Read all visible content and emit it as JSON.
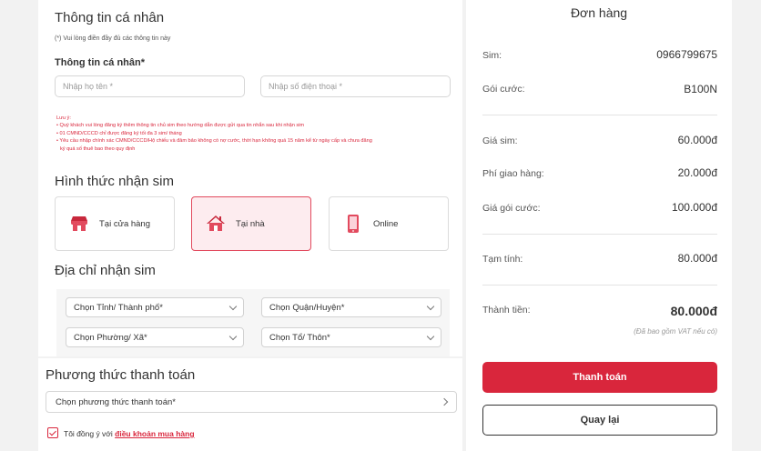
{
  "personal": {
    "title": "Thông tin cá nhân",
    "required_note": "(*) Vui lòng điền đầy đủ các thông tin này",
    "subhead": "Thông tin cá nhân*",
    "name_placeholder": "Nhập họ tên *",
    "phone_placeholder": "Nhập số điện thoại *",
    "legal_lines": [
      "Lưu ý:",
      "• Quý khách vui lòng đăng ký thêm thông tin chủ sim theo hướng dẫn được gửi qua tin nhắn sau khi nhận sim",
      "• 01 CMND/CCCD chỉ được đăng ký tối đa 3 sim/ tháng",
      "• Yêu cầu nhập chính xác CMND/CCCD/Hộ chiếu và đảm bảo không có nợ cước, thời hạn không quá 15 năm kể từ ngày cấp và chưa đăng",
      "ký quá số thuê bao theo quy định"
    ]
  },
  "delivery": {
    "title": "Hình thức nhận sim",
    "options": [
      {
        "label": "Tại cửa hàng",
        "icon": "store-icon"
      },
      {
        "label": "Tại nhà",
        "icon": "home-icon"
      },
      {
        "label": "Online",
        "icon": "phone-icon"
      }
    ],
    "selected": "Tại nhà"
  },
  "address": {
    "title": "Địa chỉ nhận sim",
    "province": "Chọn Tỉnh/ Thành phố*",
    "district": "Chọn Quận/Huyện*",
    "ward": "Chọn Phường/ Xã*",
    "hamlet": "Chọn Tổ/ Thôn*"
  },
  "payment": {
    "title": "Phương thức thanh toán",
    "select_label": "Chọn phương thức thanh toán*",
    "agree_prefix": "Tôi đồng ý với",
    "agree_link": "điều khoản mua hàng"
  },
  "order": {
    "title": "Đơn hàng",
    "sim_label": "Sim:",
    "sim_value": "0966799675",
    "plan_label": "Gói cước:",
    "plan_value": "B100N",
    "sim_price_label": "Giá sim:",
    "sim_price_value": "60.000đ",
    "shipping_label": "Phí giao hàng:",
    "shipping_value": "20.000đ",
    "plan_price_label": "Giá gói cước:",
    "plan_price_value": "100.000đ",
    "subtotal_label": "Tạm tính:",
    "subtotal_value": "80.000đ",
    "total_label": "Thành tiền:",
    "total_value": "80.000đ",
    "vat_note": "(Đã bao gồm VAT nếu có)",
    "pay_button": "Thanh toán",
    "back_button": "Quay lại"
  },
  "colors": {
    "accent": "#d9263c",
    "selected_bg": "#fdecef"
  }
}
